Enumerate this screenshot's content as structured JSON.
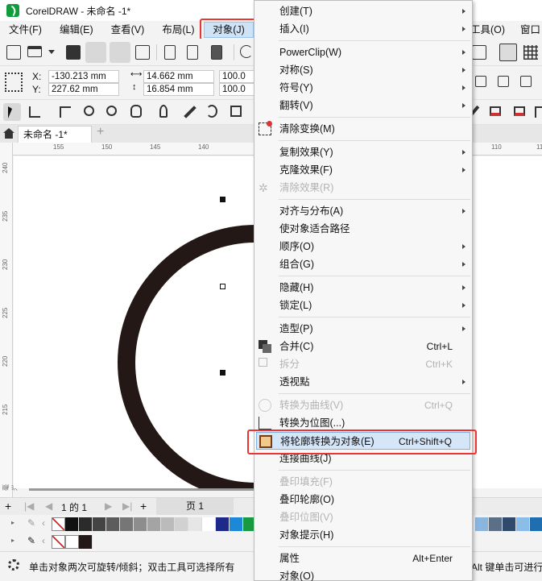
{
  "window": {
    "title": "CorelDRAW - 未命名 -1*"
  },
  "menubar": {
    "items": [
      {
        "label": "文件(F)"
      },
      {
        "label": "编辑(E)"
      },
      {
        "label": "查看(V)"
      },
      {
        "label": "布局(L)"
      },
      {
        "label": "对象(J)"
      },
      {
        "label": "工具(O)"
      },
      {
        "label": "窗口"
      }
    ]
  },
  "properties": {
    "x_label": "X:",
    "y_label": "Y:",
    "x_value": "-130.213 mm",
    "y_value": "227.62 mm",
    "width_value": "14.662 mm",
    "height_value": "16.854 mm",
    "scale_w": "100.0",
    "scale_h": "100.0"
  },
  "document_tab": {
    "label": "未命名 -1*",
    "add_label": "+"
  },
  "ruler": {
    "h_ticks": [
      "155",
      "150",
      "145",
      "140",
      "110",
      "115"
    ],
    "v_ticks": [
      "240",
      "235",
      "230",
      "225",
      "220",
      "215",
      "毫米"
    ],
    "corner": "米"
  },
  "pagebar": {
    "page_count": "1 的 1",
    "page_tab": "页 1",
    "add": "+"
  },
  "statusbar": {
    "left_text": "单击对象两次可旋转/倾斜；双击工具可选择所有",
    "right_text": "Alt 键单击可进行"
  },
  "context_menu": {
    "items": [
      {
        "label": "创建(T)",
        "submenu": true
      },
      {
        "label": "插入(I)",
        "submenu": true
      },
      {
        "label": "PowerClip(W)",
        "submenu": true
      },
      {
        "label": "对称(S)",
        "submenu": true
      },
      {
        "label": "符号(Y)",
        "submenu": true
      },
      {
        "label": "翻转(V)",
        "submenu": true
      },
      {
        "label": "清除变换(M)"
      },
      {
        "label": "复制效果(Y)",
        "submenu": true
      },
      {
        "label": "克隆效果(F)",
        "submenu": true
      },
      {
        "label": "清除效果(R)",
        "disabled": true
      },
      {
        "label": "对齐与分布(A)",
        "submenu": true
      },
      {
        "label": "使对象适合路径"
      },
      {
        "label": "顺序(O)",
        "submenu": true
      },
      {
        "label": "组合(G)",
        "submenu": true
      },
      {
        "label": "隐藏(H)",
        "submenu": true
      },
      {
        "label": "锁定(L)",
        "submenu": true
      },
      {
        "label": "造型(P)",
        "submenu": true
      },
      {
        "label": "合并(C)",
        "shortcut": "Ctrl+L"
      },
      {
        "label": "拆分",
        "shortcut": "Ctrl+K",
        "disabled": true
      },
      {
        "label": "透视點",
        "submenu": true
      },
      {
        "label": "转换为曲线(V)",
        "shortcut": "Ctrl+Q",
        "disabled": true
      },
      {
        "label": "转换为位图(...)"
      },
      {
        "label": "将轮廓转换为对象(E)",
        "shortcut": "Ctrl+Shift+Q",
        "highlighted": true
      },
      {
        "label": "连接曲线(J)"
      },
      {
        "label": "叠印填充(F)",
        "disabled": true
      },
      {
        "label": "叠印轮廓(O)"
      },
      {
        "label": "叠印位图(V)",
        "disabled": true
      },
      {
        "label": "对象提示(H)"
      },
      {
        "label": "属性",
        "shortcut": "Alt+Enter"
      },
      {
        "label": "对象(O)"
      }
    ]
  },
  "colors": {
    "highlight_bg": "#d4e6f8",
    "highlight_border": "#7cb0e3",
    "annotation_red": "#e33333",
    "ring_color": "#231815"
  }
}
